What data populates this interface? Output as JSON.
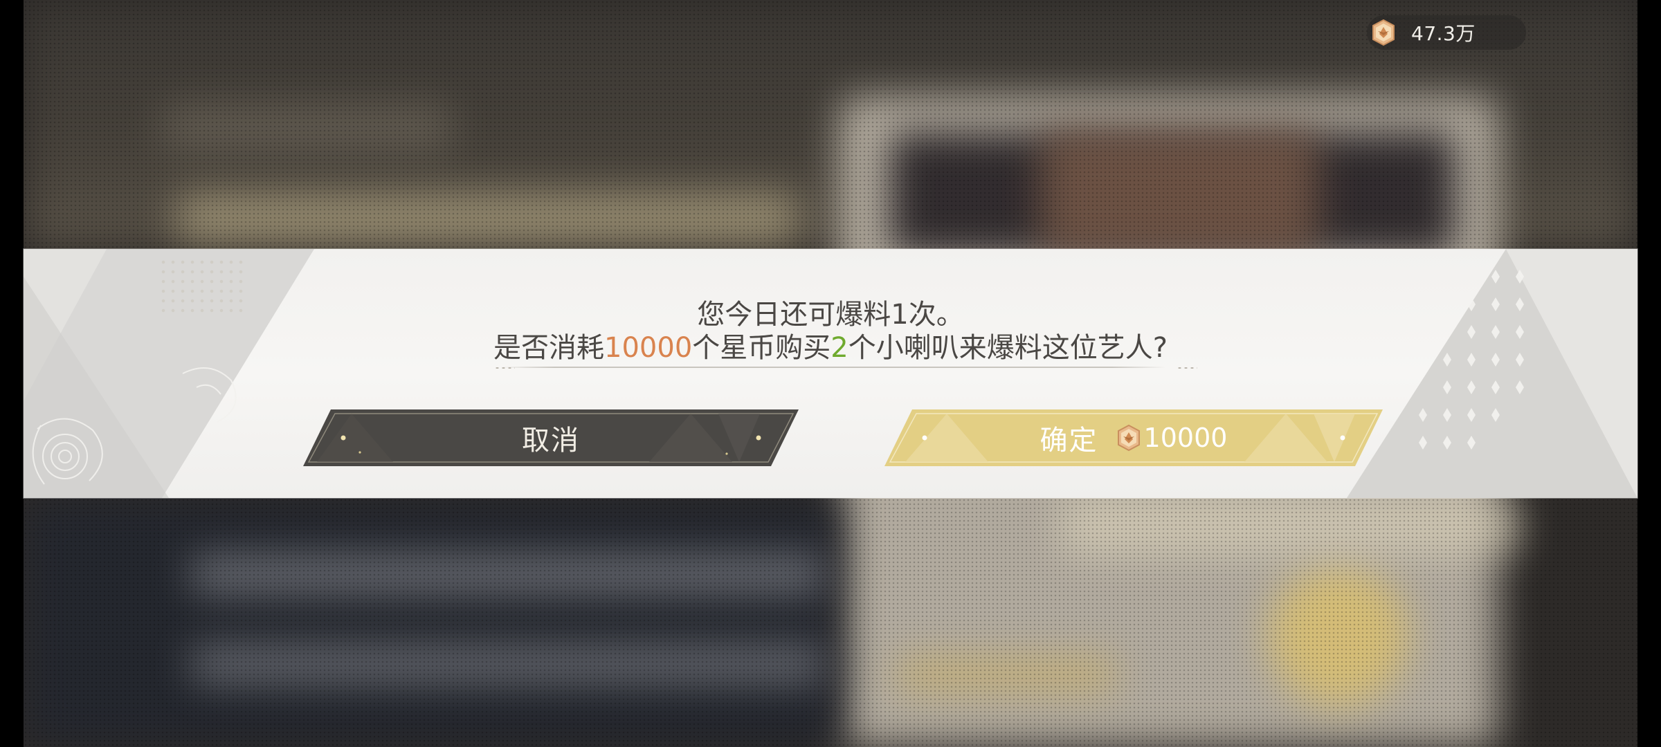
{
  "currency": {
    "icon": "star-coin-icon",
    "amount": "47.3万"
  },
  "dialog": {
    "line1": "您今日还可爆料1次。",
    "line2": {
      "prefix": "是否消耗",
      "cost": "10000",
      "middle": "个星币购买",
      "count": "2",
      "suffix": "个小喇叭来爆料这位艺人?"
    }
  },
  "buttons": {
    "cancel_label": "取消",
    "confirm_label": "确定",
    "confirm_cost": "10000",
    "confirm_icon": "star-coin-icon"
  },
  "colors": {
    "highlight_cost": "#d9834e",
    "highlight_count": "#6faa2e",
    "cancel_button": "#4a4845",
    "confirm_button": "#e3cf84",
    "dialog_background": "#f4f3f1"
  }
}
